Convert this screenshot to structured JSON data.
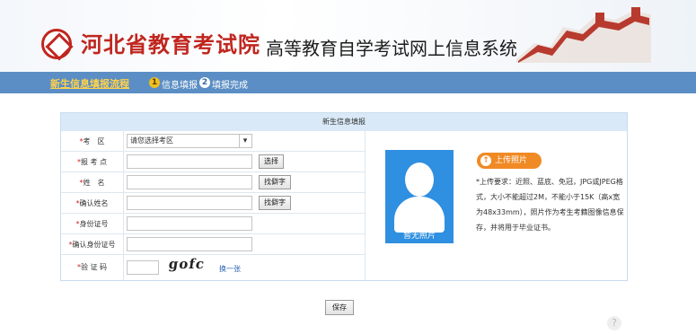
{
  "header": {
    "brand_name": "河北省教育考试院",
    "system_name": "高等教育自学考试网上信息系统"
  },
  "nav": {
    "current_link": "新生信息填报流程",
    "steps": [
      {
        "num": "1",
        "label": "信息填报"
      },
      {
        "num": "2",
        "label": "填报完成"
      }
    ]
  },
  "form": {
    "title": "新生信息填报",
    "fields": [
      {
        "label": "考　区",
        "required": "*",
        "value": "请您选择考区",
        "type": "select"
      },
      {
        "label": "报 考 点",
        "required": "*",
        "value": "",
        "button": "选择"
      },
      {
        "label": "姓　名",
        "required": "*",
        "value": "",
        "button": "找僻字"
      },
      {
        "label": "确认姓名",
        "required": "*",
        "value": "",
        "button": "找僻字"
      },
      {
        "label": "身份证号",
        "required": "*",
        "value": ""
      },
      {
        "label": "确认身份证号",
        "required": "*",
        "value": ""
      },
      {
        "label": "验 证 码",
        "required": "*",
        "value": ""
      }
    ],
    "captcha_text": "gofc",
    "refresh_label": "换一张"
  },
  "photo": {
    "placeholder": "暂无照片",
    "upload_label": "上传照片",
    "upload_icon": "upload-icon",
    "requirements": "*上传要求：近照、蓝底、免冠，JPG或JPEG格式，大小不能超过2M，不能小于15K（高x宽为48x33mm），照片作为考生考籍图像信息保存，并将用于毕业证书。"
  },
  "save_label": "保存",
  "colors": {
    "brand_red": "#c0261f",
    "nav_blue": "#5b8ec4",
    "photo_blue": "#2f8fe0",
    "upload_orange": "#f08a24"
  }
}
